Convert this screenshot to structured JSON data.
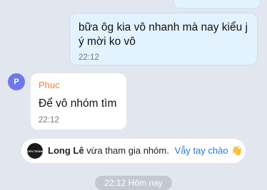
{
  "messages": {
    "outgoing": {
      "text": "bữa ôg kia vô nhanh mà nay kiểu j ý mời ko vô",
      "time": "22:12"
    },
    "incoming": {
      "avatar_initial": "P",
      "sender": "Phuc",
      "text": "Để vô nhóm tìm",
      "time": "22:12"
    }
  },
  "system": {
    "avatar_text": "CRV.TEAM",
    "name": "Long Lê",
    "action": "vừa tham gia nhóm.",
    "wave_label": "Vẫy tay chào",
    "emoji": "👋"
  },
  "date_separator": "22:12 Hôm nay",
  "colors": {
    "background": "#e1e6ef",
    "outgoing_bubble": "#e3f2ff",
    "incoming_bubble": "#ffffff",
    "sender_name": "#ee7e42",
    "avatar": "#6f78e8",
    "link": "#1e7be0"
  }
}
